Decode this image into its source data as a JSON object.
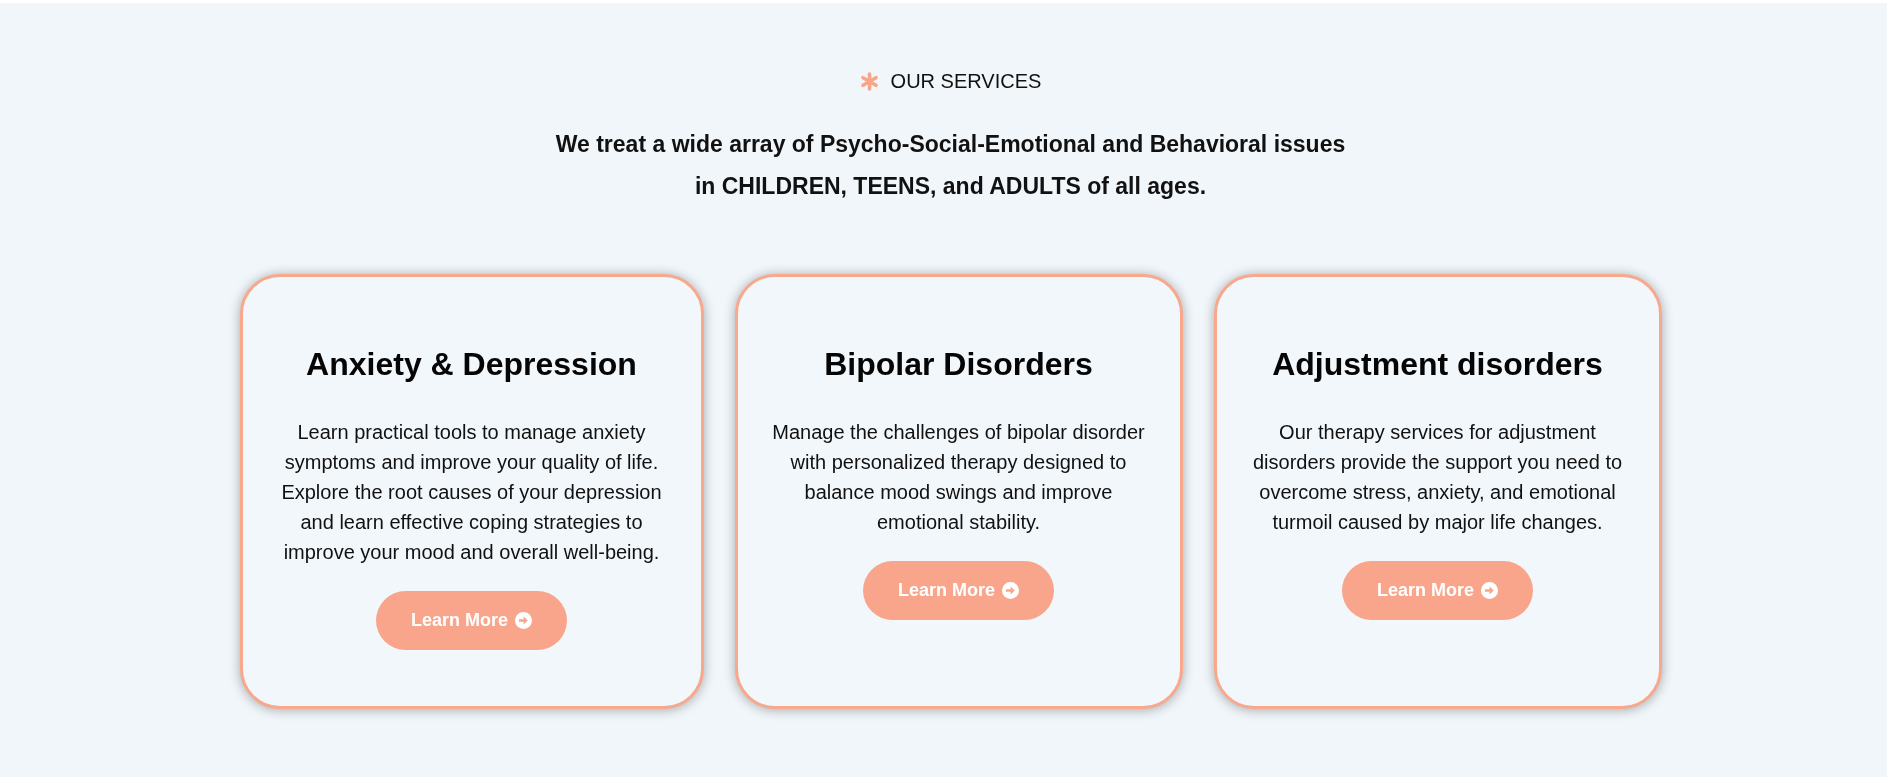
{
  "section": {
    "eyebrow": "OUR SERVICES",
    "heading": "We treat a wide array of Psycho-Social-Emotional and Behavioral issues in CHILDREN, TEENS, and ADULTS of all ages."
  },
  "cards": [
    {
      "title": "Anxiety & Depression",
      "description": "Learn practical tools to manage anxiety symptoms and improve your quality of life. Explore the root causes of your depression and learn effective coping strategies to improve your mood and overall well-being.",
      "button": "Learn More"
    },
    {
      "title": "Bipolar Disorders",
      "description": "Manage the challenges of bipolar disorder with personalized therapy designed to balance mood swings and improve emotional stability.",
      "button": "Learn More"
    },
    {
      "title": "Adjustment disorders",
      "description": "Our therapy services for adjustment disorders provide the support you need to overcome stress, anxiety, and emotional turmoil caused by major life changes.",
      "button": "Learn More"
    }
  ]
}
